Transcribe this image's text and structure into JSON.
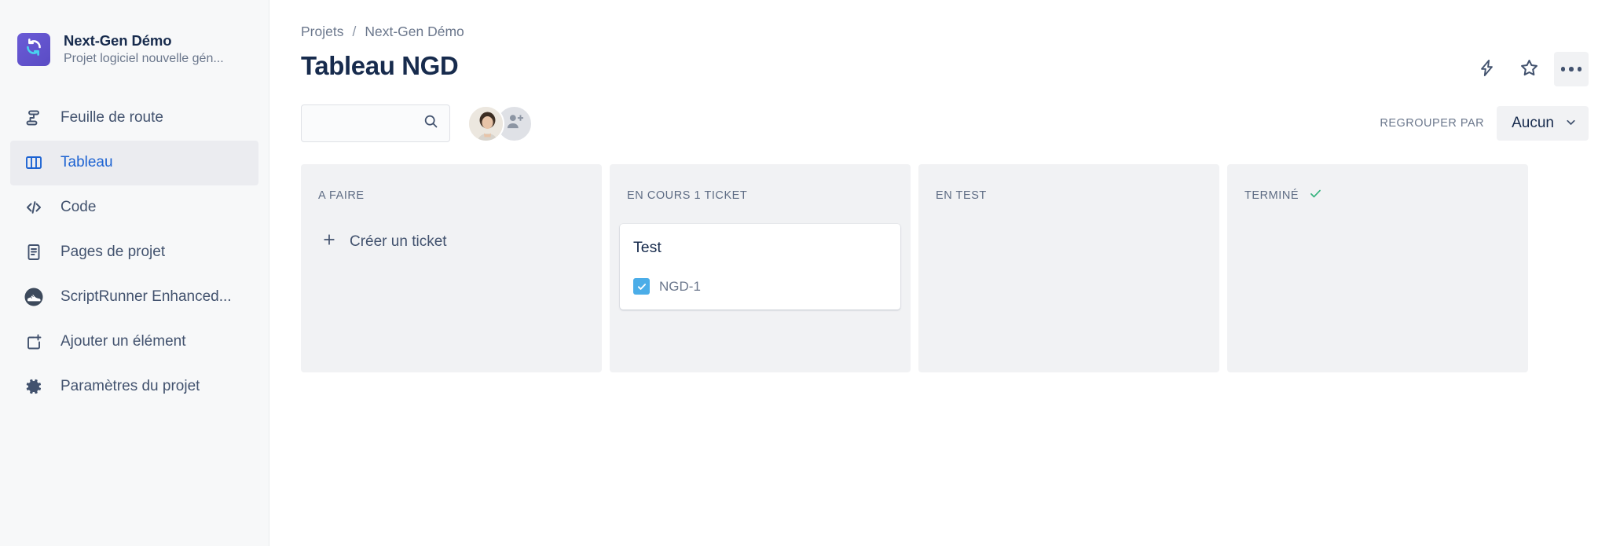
{
  "sidebar": {
    "project": {
      "name": "Next-Gen Démo",
      "subtitle": "Projet logiciel nouvelle gén...",
      "logo_icon": "refresh-circle-icon",
      "logo_color": "#5a4cc4"
    },
    "items": [
      {
        "label": "Feuille de route",
        "icon": "roadmap-icon",
        "active": false
      },
      {
        "label": "Tableau",
        "icon": "board-columns-icon",
        "active": true
      },
      {
        "label": "Code",
        "icon": "code-brackets-icon",
        "active": false
      },
      {
        "label": "Pages de projet",
        "icon": "document-page-icon",
        "active": false
      },
      {
        "label": "ScriptRunner Enhanced...",
        "icon": "scriptrunner-shoe-icon",
        "active": false
      },
      {
        "label": "Ajouter un élément",
        "icon": "add-item-icon",
        "active": false
      },
      {
        "label": "Paramètres du projet",
        "icon": "gear-icon",
        "active": false
      }
    ],
    "active_color": "#1d63d2"
  },
  "header": {
    "breadcrumb": {
      "root": "Projets",
      "separator": "/",
      "current": "Next-Gen Démo"
    },
    "title": "Tableau NGD",
    "actions": [
      {
        "name": "automation-bolt-icon",
        "label": ""
      },
      {
        "name": "star-favorite-icon",
        "label": ""
      },
      {
        "name": "more-actions-icon",
        "label": ""
      }
    ]
  },
  "toolbar": {
    "search": {
      "value": "",
      "placeholder": "",
      "icon": "search-icon"
    },
    "avatars": [
      {
        "name": "user-avatar",
        "type": "photo"
      },
      {
        "name": "add-person-button",
        "type": "add",
        "icon": "person-plus-icon"
      }
    ],
    "group_by": {
      "label": "REGROUPER PAR",
      "value": "Aucun",
      "chevron": "chevron-down-icon"
    }
  },
  "board": {
    "columns": [
      {
        "title": "A FAIRE",
        "done": false,
        "create_label": "Créer un ticket",
        "show_create": true,
        "cards": []
      },
      {
        "title": "EN COURS 1 TICKET",
        "done": false,
        "create_label": "",
        "show_create": false,
        "cards": [
          {
            "title": "Test",
            "key": "NGD-1",
            "type_icon": "task-checkbox-icon",
            "type_color": "#4bade8"
          }
        ]
      },
      {
        "title": "EN TEST",
        "done": false,
        "create_label": "",
        "show_create": false,
        "cards": []
      },
      {
        "title": "TERMINÉ",
        "done": true,
        "done_icon": "check-icon",
        "done_color": "#36b37e",
        "create_label": "",
        "show_create": false,
        "cards": []
      }
    ]
  }
}
